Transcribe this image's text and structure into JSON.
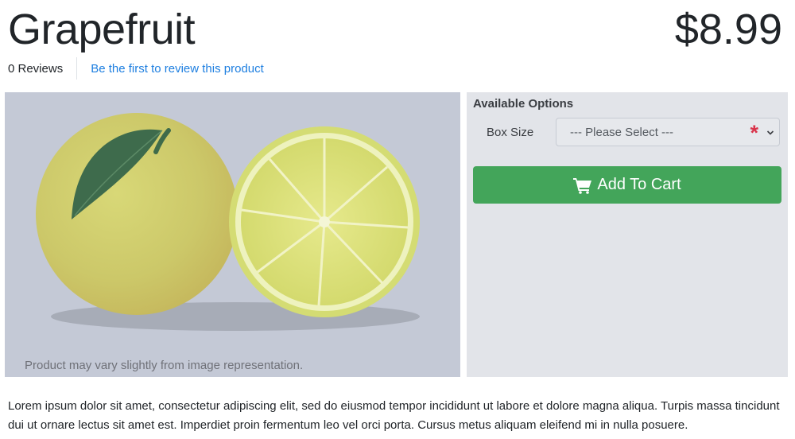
{
  "product": {
    "title": "Grapefruit",
    "price": "$8.99"
  },
  "reviews": {
    "count_label": "0 Reviews",
    "link_label": "Be the first to review this product"
  },
  "image": {
    "caption": "Product may vary slightly from image representation."
  },
  "options": {
    "heading": "Available Options",
    "box_size_label": "Box Size",
    "select_value": "--- Please Select ---",
    "required_marker": "*"
  },
  "cart": {
    "button_label": "Add To Cart",
    "button_color": "#43a55a",
    "icon": "cart-icon"
  },
  "description": "Lorem ipsum dolor sit amet, consectetur adipiscing elit, sed do eiusmod tempor incididunt ut labore et dolore magna aliqua. Turpis massa tincidunt dui ut ornare lectus sit amet est. Imperdiet proin fermentum leo vel orci porta. Cursus metus aliquam eleifend mi in nulla posuere."
}
